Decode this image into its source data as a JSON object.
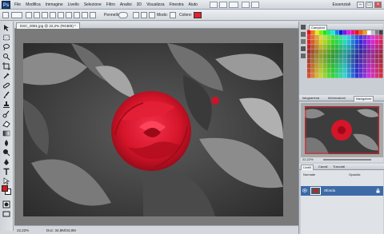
{
  "app": {
    "logo": "Ps",
    "workspace": "Essenziali",
    "menu": [
      "File",
      "Modifica",
      "Immagine",
      "Livello",
      "Selezione",
      "Filtro",
      "Analisi",
      "3D",
      "Visualizza",
      "Finestra",
      "Aiuto"
    ]
  },
  "options": {
    "pennello_label": "Pennello:",
    "modo_label": "Modo:",
    "colore_label": "Colore:",
    "color": "#e8202b"
  },
  "document": {
    "tab_title": "DSC_0081.jpg @ 22,2% (RGB/8) *",
    "zoom": "22,22%",
    "doc_size": "Doc: 34,8M/34,8M"
  },
  "panels": {
    "top_tab": "Campioni",
    "mid_tabs": [
      "Istogramma",
      "Informazioni",
      "Navigatore"
    ],
    "layers_tabs": [
      "Livelli",
      "Canali",
      "Tracciati"
    ],
    "blend_mode": "Normale",
    "opacity_label": "Opacità:",
    "layer_name": "Sfondo",
    "nav_zoom": "22,22%"
  },
  "colors": {
    "foreground": "#d8191f",
    "background": "#ffffff",
    "accent_red": "#d5152a"
  }
}
